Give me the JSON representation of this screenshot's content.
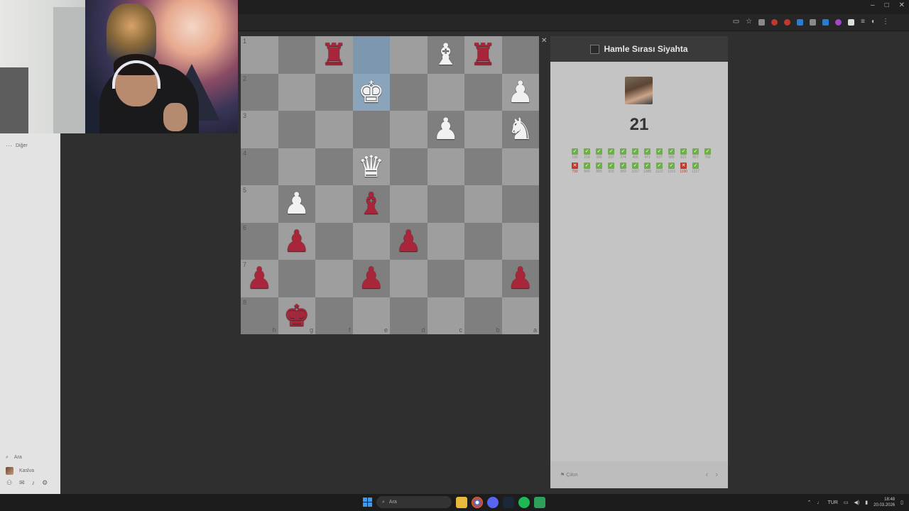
{
  "window": {
    "minimize_label": "–",
    "maximize_label": "□",
    "close_label": "✕"
  },
  "sidebar": {
    "more_label": "Diğer",
    "search_label": "Ara",
    "profile_label": "Kaslva"
  },
  "board": {
    "ranks": [
      "1",
      "2",
      "3",
      "4",
      "5",
      "6",
      "7",
      "8"
    ],
    "files": [
      "h",
      "g",
      "f",
      "e",
      "d",
      "c",
      "b",
      "a"
    ],
    "highlighted_squares": [
      "e1",
      "e2"
    ],
    "rows": [
      [
        "",
        "",
        "r:♜",
        "",
        "",
        "w:♝",
        "r:♜",
        ""
      ],
      [
        "",
        "",
        "",
        "w:♚",
        "",
        "",
        "",
        "w:♟"
      ],
      [
        "",
        "",
        "",
        "",
        "",
        "w:♟",
        "",
        "w:♞"
      ],
      [
        "",
        "",
        "",
        "w:♛",
        "",
        "",
        "",
        ""
      ],
      [
        "",
        "w:♟",
        "",
        "r:♝",
        "",
        "",
        "",
        ""
      ],
      [
        "",
        "r:♟",
        "",
        "",
        "r:♟",
        "",
        "",
        ""
      ],
      [
        "r:♟",
        "",
        "",
        "r:♟",
        "",
        "",
        "",
        "r:♟"
      ],
      [
        "",
        "r:♚",
        "",
        "",
        "",
        "",
        "",
        ""
      ]
    ]
  },
  "panel": {
    "title": "Hamle Sırası Siyahta",
    "score": "21",
    "results": [
      [
        {
          "status": "ok",
          "value": "190"
        },
        {
          "status": "ok",
          "value": "218"
        },
        {
          "status": "ok",
          "value": "285"
        },
        {
          "status": "ok",
          "value": "337"
        },
        {
          "status": "ok",
          "value": "374"
        },
        {
          "status": "ok",
          "value": "405"
        },
        {
          "status": "ok",
          "value": "471"
        },
        {
          "status": "ok",
          "value": "527"
        },
        {
          "status": "ok",
          "value": "585"
        },
        {
          "status": "ok",
          "value": "621"
        },
        {
          "status": "ok",
          "value": "657"
        },
        {
          "status": "ok",
          "value": "702"
        }
      ],
      [
        {
          "status": "bad",
          "value": "790"
        },
        {
          "status": "ok",
          "value": "843"
        },
        {
          "status": "ok",
          "value": "880"
        },
        {
          "status": "ok",
          "value": "933"
        },
        {
          "status": "ok",
          "value": "969"
        },
        {
          "status": "ok",
          "value": "1017"
        },
        {
          "status": "ok",
          "value": "1088"
        },
        {
          "status": "ok",
          "value": "1122"
        },
        {
          "status": "ok",
          "value": "1153"
        },
        {
          "status": "bad",
          "value": "1190"
        },
        {
          "status": "ok",
          "value": "1217"
        }
      ]
    ],
    "exit_label": "Çıkın",
    "prev_label": "‹",
    "next_label": "›"
  },
  "taskbar": {
    "search_placeholder": "Ara",
    "language": "TUR",
    "time": "18:48",
    "date": "20.03.2026"
  },
  "colors": {
    "light_square": "#9e9e9e",
    "dark_square": "#7f7f7f",
    "highlight": "#8aa4bc",
    "red_piece": "#a8253a",
    "ok": "#6fae4a",
    "bad": "#c0392b"
  }
}
